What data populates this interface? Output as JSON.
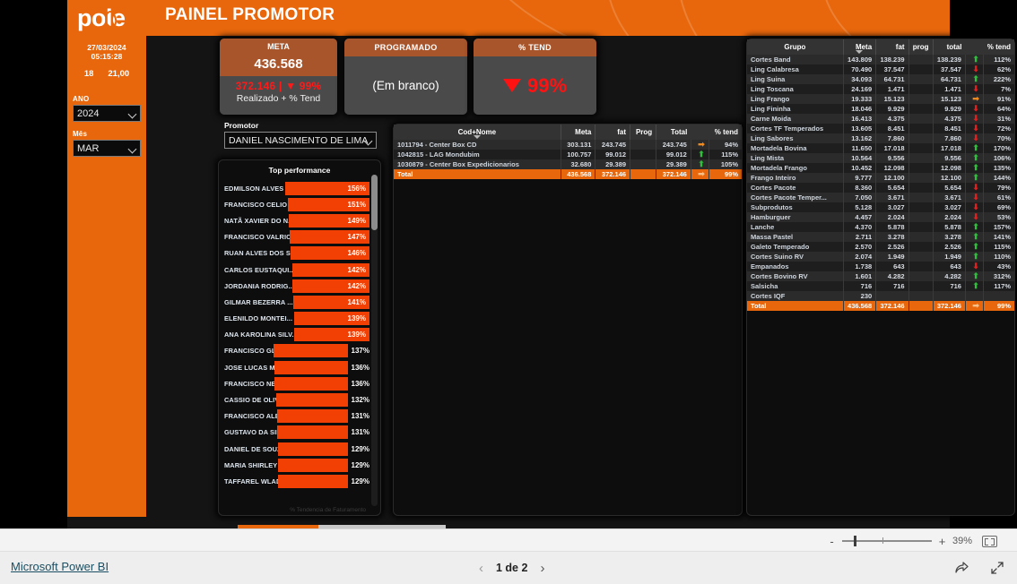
{
  "header": {
    "logo_text": "pole",
    "title": "PAINEL PROMOTOR"
  },
  "sidebar": {
    "date": "27/03/2024",
    "time": "05:15:28",
    "metric_left": "18",
    "metric_right": "21,00",
    "filters": [
      {
        "label": "ANO",
        "value": "2024"
      },
      {
        "label": "Mês",
        "value": "MAR"
      }
    ]
  },
  "cards": {
    "meta": {
      "title": "META",
      "value": "436.568",
      "realized": "372.146",
      "separator": "|",
      "trend_pct": "99%",
      "trend_dir": "down",
      "subtitle": "Realizado + % Tend"
    },
    "programado": {
      "title": "PROGRAMADO",
      "value": "(Em branco)"
    },
    "tend": {
      "title": "% TEND",
      "value": "99%",
      "trend_dir": "down"
    }
  },
  "promotor": {
    "label": "Promotor",
    "value": "DANIEL NASCIMENTO DE LIMA"
  },
  "top_performance": {
    "title": "Top performance",
    "footnote": "% Tendencia de Faturamento",
    "columns": [
      "nome",
      "pct"
    ],
    "rows": [
      {
        "nome": "EDMILSON ALVES D...",
        "pct": "156%",
        "value": 156
      },
      {
        "nome": "FRANCISCO CELIO ...",
        "pct": "151%",
        "value": 151
      },
      {
        "nome": "NATÃ XAVIER DO N...",
        "pct": "149%",
        "value": 149
      },
      {
        "nome": "FRANCISCO VALRIC...",
        "pct": "147%",
        "value": 147
      },
      {
        "nome": "RUAN ALVES DOS S...",
        "pct": "146%",
        "value": 146
      },
      {
        "nome": "CARLOS EUSTAQUI...",
        "pct": "142%",
        "value": 142
      },
      {
        "nome": "JORDANIA RODRIG...",
        "pct": "142%",
        "value": 142
      },
      {
        "nome": "GILMAR BEZERRA ...",
        "pct": "141%",
        "value": 141
      },
      {
        "nome": "ELENILDO MONTEI...",
        "pct": "139%",
        "value": 139
      },
      {
        "nome": "ANA KAROLINA SILV...",
        "pct": "139%",
        "value": 139
      },
      {
        "nome": "FRANCISCO GLEID...",
        "pct": "137%",
        "value": 137
      },
      {
        "nome": "JOSE LUCAS MELO ...",
        "pct": "136%",
        "value": 136
      },
      {
        "nome": "FRANCISCO NEWT...",
        "pct": "136%",
        "value": 136
      },
      {
        "nome": "CASSIO DE OLIVEIR...",
        "pct": "132%",
        "value": 132
      },
      {
        "nome": "FRANCISCO ALEXA...",
        "pct": "131%",
        "value": 131
      },
      {
        "nome": "GUSTAVO DA SILVA ...",
        "pct": "131%",
        "value": 131
      },
      {
        "nome": "DANIEL DE SOUZA ...",
        "pct": "129%",
        "value": 129
      },
      {
        "nome": "MARIA SHIRLEY DE ...",
        "pct": "129%",
        "value": 129
      },
      {
        "nome": "TAFFAREL WLADSO...",
        "pct": "129%",
        "value": 129
      }
    ]
  },
  "center_table": {
    "columns": [
      "Cod+Nome",
      "Meta",
      "fat",
      "Prog",
      "Total",
      "% tend"
    ],
    "sorted_column": "Cod+Nome",
    "rows": [
      {
        "cod_nome": "1011794 - Center Box CD",
        "meta": "303.131",
        "fat": "243.745",
        "prog": "",
        "total": "243.745",
        "ind": "flat",
        "tend": "94%"
      },
      {
        "cod_nome": "1042815 - LAG Mondubim",
        "meta": "100.757",
        "fat": "99.012",
        "prog": "",
        "total": "99.012",
        "ind": "up",
        "tend": "115%"
      },
      {
        "cod_nome": "1030879 - Center Box Expedicionarios",
        "meta": "32.680",
        "fat": "29.389",
        "prog": "",
        "total": "29.389",
        "ind": "up",
        "tend": "105%"
      }
    ],
    "total": {
      "label": "Total",
      "meta": "436.568",
      "fat": "372.146",
      "prog": "",
      "total": "372.146",
      "ind": "flat",
      "tend": "99%"
    }
  },
  "right_table": {
    "columns": [
      "Grupo",
      "Meta",
      "fat",
      "prog",
      "total",
      "% tend"
    ],
    "sorted_column": "Meta",
    "rows": [
      {
        "grupo": "Cortes Band",
        "meta": "143.809",
        "fat": "138.239",
        "prog": "",
        "total": "138.239",
        "ind": "up",
        "tend": "112%"
      },
      {
        "grupo": "Ling Calabresa",
        "meta": "70.490",
        "fat": "37.547",
        "prog": "",
        "total": "37.547",
        "ind": "down",
        "tend": "62%"
      },
      {
        "grupo": "Ling Suina",
        "meta": "34.093",
        "fat": "64.731",
        "prog": "",
        "total": "64.731",
        "ind": "up",
        "tend": "222%"
      },
      {
        "grupo": "Ling Toscana",
        "meta": "24.169",
        "fat": "1.471",
        "prog": "",
        "total": "1.471",
        "ind": "down",
        "tend": "7%"
      },
      {
        "grupo": "Ling Frango",
        "meta": "19.333",
        "fat": "15.123",
        "prog": "",
        "total": "15.123",
        "ind": "flat",
        "tend": "91%"
      },
      {
        "grupo": "Ling Fininha",
        "meta": "18.046",
        "fat": "9.929",
        "prog": "",
        "total": "9.929",
        "ind": "down",
        "tend": "64%"
      },
      {
        "grupo": "Carne Moida",
        "meta": "16.413",
        "fat": "4.375",
        "prog": "",
        "total": "4.375",
        "ind": "down",
        "tend": "31%"
      },
      {
        "grupo": "Cortes TF Temperados",
        "meta": "13.605",
        "fat": "8.451",
        "prog": "",
        "total": "8.451",
        "ind": "down",
        "tend": "72%"
      },
      {
        "grupo": "Ling Sabores",
        "meta": "13.162",
        "fat": "7.860",
        "prog": "",
        "total": "7.860",
        "ind": "down",
        "tend": "70%"
      },
      {
        "grupo": "Mortadela Bovina",
        "meta": "11.650",
        "fat": "17.018",
        "prog": "",
        "total": "17.018",
        "ind": "up",
        "tend": "170%"
      },
      {
        "grupo": "Ling Mista",
        "meta": "10.564",
        "fat": "9.556",
        "prog": "",
        "total": "9.556",
        "ind": "up",
        "tend": "106%"
      },
      {
        "grupo": "Mortadela Frango",
        "meta": "10.452",
        "fat": "12.098",
        "prog": "",
        "total": "12.098",
        "ind": "up",
        "tend": "135%"
      },
      {
        "grupo": "Frango Inteiro",
        "meta": "9.777",
        "fat": "12.100",
        "prog": "",
        "total": "12.100",
        "ind": "up",
        "tend": "144%"
      },
      {
        "grupo": "Cortes Pacote",
        "meta": "8.360",
        "fat": "5.654",
        "prog": "",
        "total": "5.654",
        "ind": "down",
        "tend": "79%"
      },
      {
        "grupo": "Cortes Pacote Temper...",
        "meta": "7.050",
        "fat": "3.671",
        "prog": "",
        "total": "3.671",
        "ind": "down",
        "tend": "61%"
      },
      {
        "grupo": "Subprodutos",
        "meta": "5.128",
        "fat": "3.027",
        "prog": "",
        "total": "3.027",
        "ind": "down",
        "tend": "69%"
      },
      {
        "grupo": "Hamburguer",
        "meta": "4.457",
        "fat": "2.024",
        "prog": "",
        "total": "2.024",
        "ind": "down",
        "tend": "53%"
      },
      {
        "grupo": "Lanche",
        "meta": "4.370",
        "fat": "5.878",
        "prog": "",
        "total": "5.878",
        "ind": "up",
        "tend": "157%"
      },
      {
        "grupo": "Massa Pastel",
        "meta": "2.711",
        "fat": "3.278",
        "prog": "",
        "total": "3.278",
        "ind": "up",
        "tend": "141%"
      },
      {
        "grupo": "Galeto Temperado",
        "meta": "2.570",
        "fat": "2.526",
        "prog": "",
        "total": "2.526",
        "ind": "up",
        "tend": "115%"
      },
      {
        "grupo": "Cortes Suino RV",
        "meta": "2.074",
        "fat": "1.949",
        "prog": "",
        "total": "1.949",
        "ind": "up",
        "tend": "110%"
      },
      {
        "grupo": "Empanados",
        "meta": "1.738",
        "fat": "643",
        "prog": "",
        "total": "643",
        "ind": "down",
        "tend": "43%"
      },
      {
        "grupo": "Cortes Bovino RV",
        "meta": "1.601",
        "fat": "4.282",
        "prog": "",
        "total": "4.282",
        "ind": "up",
        "tend": "312%"
      },
      {
        "grupo": "Salsicha",
        "meta": "716",
        "fat": "716",
        "prog": "",
        "total": "716",
        "ind": "up",
        "tend": "117%"
      },
      {
        "grupo": "Cortes IQF",
        "meta": "230",
        "fat": "",
        "prog": "",
        "total": "",
        "ind": "",
        "tend": ""
      }
    ],
    "total": {
      "grupo": "Total",
      "meta": "436.568",
      "fat": "372.146",
      "prog": "",
      "total": "372.146",
      "ind": "flat",
      "tend": "99%"
    }
  },
  "statusbar": {
    "zoom_minus": "-",
    "zoom_plus": "+",
    "zoom_value": "39%"
  },
  "footer": {
    "brand": "Microsoft Power BI",
    "page": "1 de 2",
    "prev": "‹",
    "next": "›"
  },
  "colors": {
    "brand_orange": "#E8670C",
    "bar_orange": "#F24005",
    "card_header": "#A9552B",
    "red": "#FF1212",
    "green": "#2FBF3C",
    "canvas_dark": "#141414"
  }
}
